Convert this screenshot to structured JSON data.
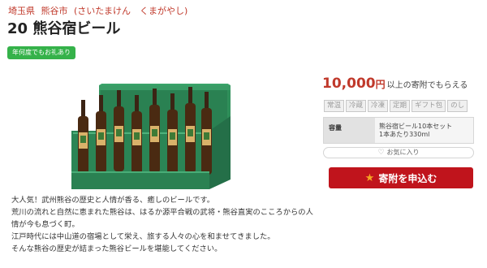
{
  "breadcrumb": {
    "prefecture": "埼玉県",
    "city": "熊谷市",
    "reading": "(さいたまけん　くまがやし)"
  },
  "product": {
    "title": "20 熊谷宿ビール",
    "badge": "年何度でもお礼あり"
  },
  "pricing": {
    "amount": "10,000",
    "unit": "円",
    "note": "以上の寄附でもらえる"
  },
  "tags": [
    "常温",
    "冷蔵",
    "冷凍",
    "定期",
    "ギフト包",
    "のし"
  ],
  "spec": {
    "key": "容量",
    "line1": "熊谷宿ビール10本セット",
    "line2": "1本あたり330ml"
  },
  "favorite": {
    "icon": "heart-icon",
    "label": "お気に入り"
  },
  "apply": {
    "icon": "star-icon",
    "label": "寄附を申込む"
  },
  "description": [
    "大人気！武州熊谷の歴史と人情が香る、癒しのビールです。",
    "荒川の流れと自然に恵まれた熊谷は、はるか源平合戦の武将・熊谷直実のこころからの人",
    "情が今も息づく町。",
    "江戸時代には中山道の宿場として栄え、旅する人々の心を和ませてきました。",
    "そんな熊谷の歴史が詰まった熊谷ビールを堪能してください。"
  ],
  "colors": {
    "accent": "#c0392b",
    "button": "#c0141c",
    "badge": "#35b24a",
    "box": "#2e8b57"
  }
}
